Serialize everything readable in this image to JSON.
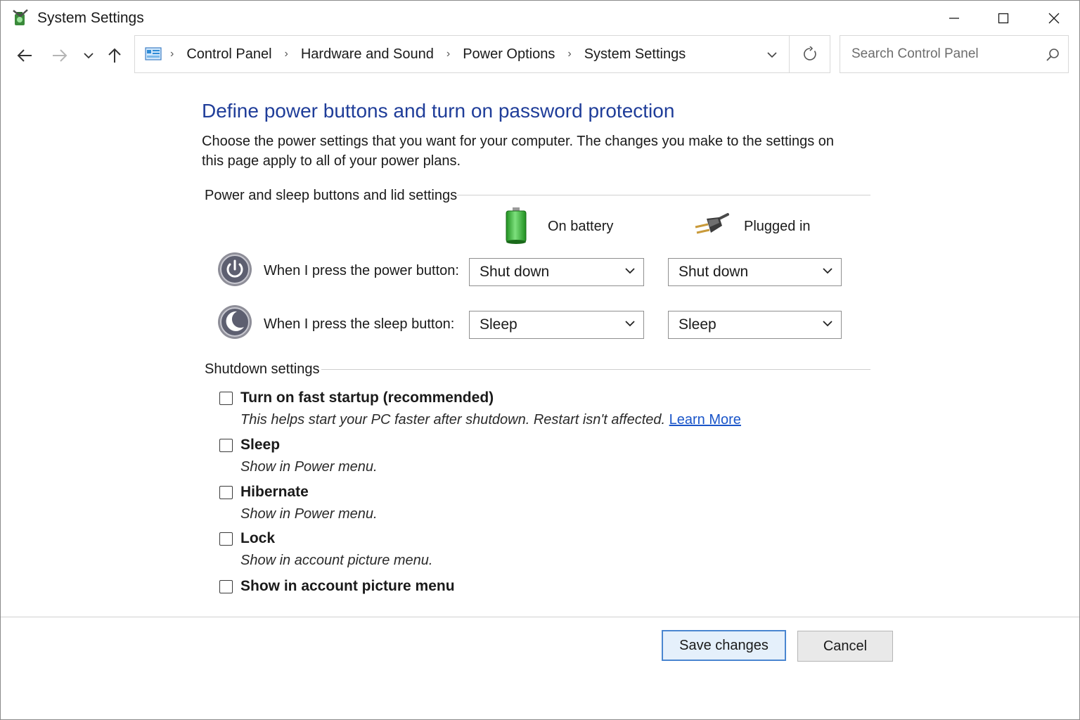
{
  "window": {
    "title": "System Settings",
    "controls": {
      "minimize": "minimize",
      "maximize": "maximize",
      "close": "close"
    }
  },
  "nav": {
    "breadcrumbs": [
      "Control Panel",
      "Hardware and Sound",
      "Power Options",
      "System Settings"
    ],
    "search_placeholder": "Search Control Panel"
  },
  "page": {
    "heading": "Define power buttons and turn on password protection",
    "description": "Choose the power settings that you want for your computer. The changes you make to the settings on this page apply to all of your power plans."
  },
  "power_section": {
    "label": "Power and sleep buttons and lid settings",
    "columns": {
      "battery": "On battery",
      "plugged": "Plugged in"
    },
    "rows": [
      {
        "label": "When I press the power button:",
        "battery": "Shut down",
        "plugged": "Shut down",
        "icon": "power-icon"
      },
      {
        "label": "When I press the sleep button:",
        "battery": "Sleep",
        "plugged": "Sleep",
        "icon": "sleep-moon-icon"
      }
    ]
  },
  "shutdown_section": {
    "label": "Shutdown settings",
    "options": [
      {
        "label": "Turn on fast startup (recommended)",
        "desc": "This helps start your PC faster after shutdown. Restart isn't affected.",
        "link": "Learn More",
        "checked": false
      },
      {
        "label": "Sleep",
        "desc": "Show in Power menu.",
        "checked": false
      },
      {
        "label": "Hibernate",
        "desc": "Show in Power menu.",
        "checked": false
      },
      {
        "label": "Lock",
        "desc": "Show in account picture menu.",
        "checked": false
      },
      {
        "label": "Show in account picture menu",
        "checked": false
      }
    ]
  },
  "footer": {
    "save": "Save changes",
    "cancel": "Cancel"
  },
  "colors": {
    "heading": "#1f3d99",
    "link": "#1a55c9",
    "primary_border": "#4a86d0",
    "battery_green": "#2fb52f"
  }
}
